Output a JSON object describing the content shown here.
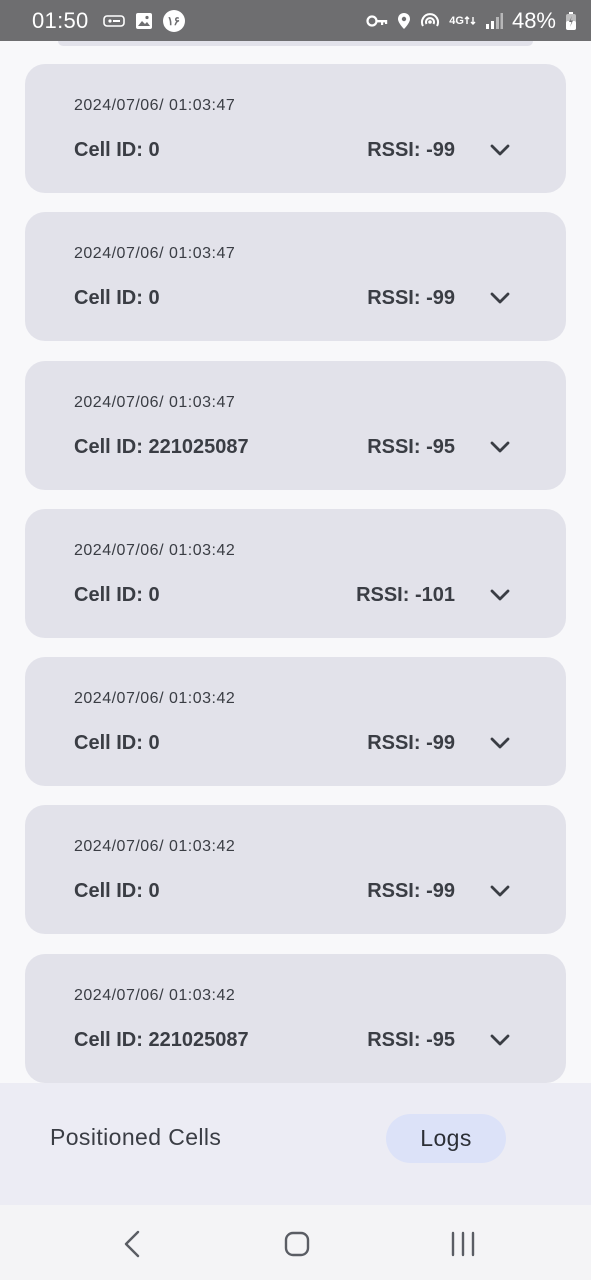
{
  "status_bar": {
    "time": "01:50",
    "badge_text": "۱۶",
    "network_type": "4G",
    "battery_percent": "48%",
    "left_icons": [
      "vpn-key-icon",
      "image-icon",
      "notification-badge-icon"
    ],
    "right_icons": [
      "key-icon",
      "location-pin-icon",
      "hotspot-icon",
      "signal-icon",
      "battery-icon"
    ]
  },
  "logs": [
    {
      "timestamp": "2024/07/06/ 01:03:47",
      "cell_id": "Cell ID: 0",
      "rssi": "RSSI: -99"
    },
    {
      "timestamp": "2024/07/06/ 01:03:47",
      "cell_id": "Cell ID: 0",
      "rssi": "RSSI: -99"
    },
    {
      "timestamp": "2024/07/06/ 01:03:47",
      "cell_id": "Cell ID: 221025087",
      "rssi": "RSSI: -95"
    },
    {
      "timestamp": "2024/07/06/ 01:03:42",
      "cell_id": "Cell ID: 0",
      "rssi": "RSSI: -101"
    },
    {
      "timestamp": "2024/07/06/ 01:03:42",
      "cell_id": "Cell ID: 0",
      "rssi": "RSSI: -99"
    },
    {
      "timestamp": "2024/07/06/ 01:03:42",
      "cell_id": "Cell ID: 0",
      "rssi": "RSSI: -99"
    },
    {
      "timestamp": "2024/07/06/ 01:03:42",
      "cell_id": "Cell ID: 221025087",
      "rssi": "RSSI: -95"
    }
  ],
  "bottom_nav": {
    "tab_positioned": "Positioned Cells",
    "tab_logs": "Logs",
    "selected": "Logs"
  },
  "system_nav": {
    "icons": [
      "back-icon",
      "home-icon",
      "recents-icon"
    ]
  },
  "colors": {
    "card_bg": "#e2e2ea",
    "page_bg": "#f8f8fa",
    "status_bar_bg": "#6e6e70",
    "selected_tab_bg": "#dce2f8",
    "text": "#3a3d44"
  }
}
